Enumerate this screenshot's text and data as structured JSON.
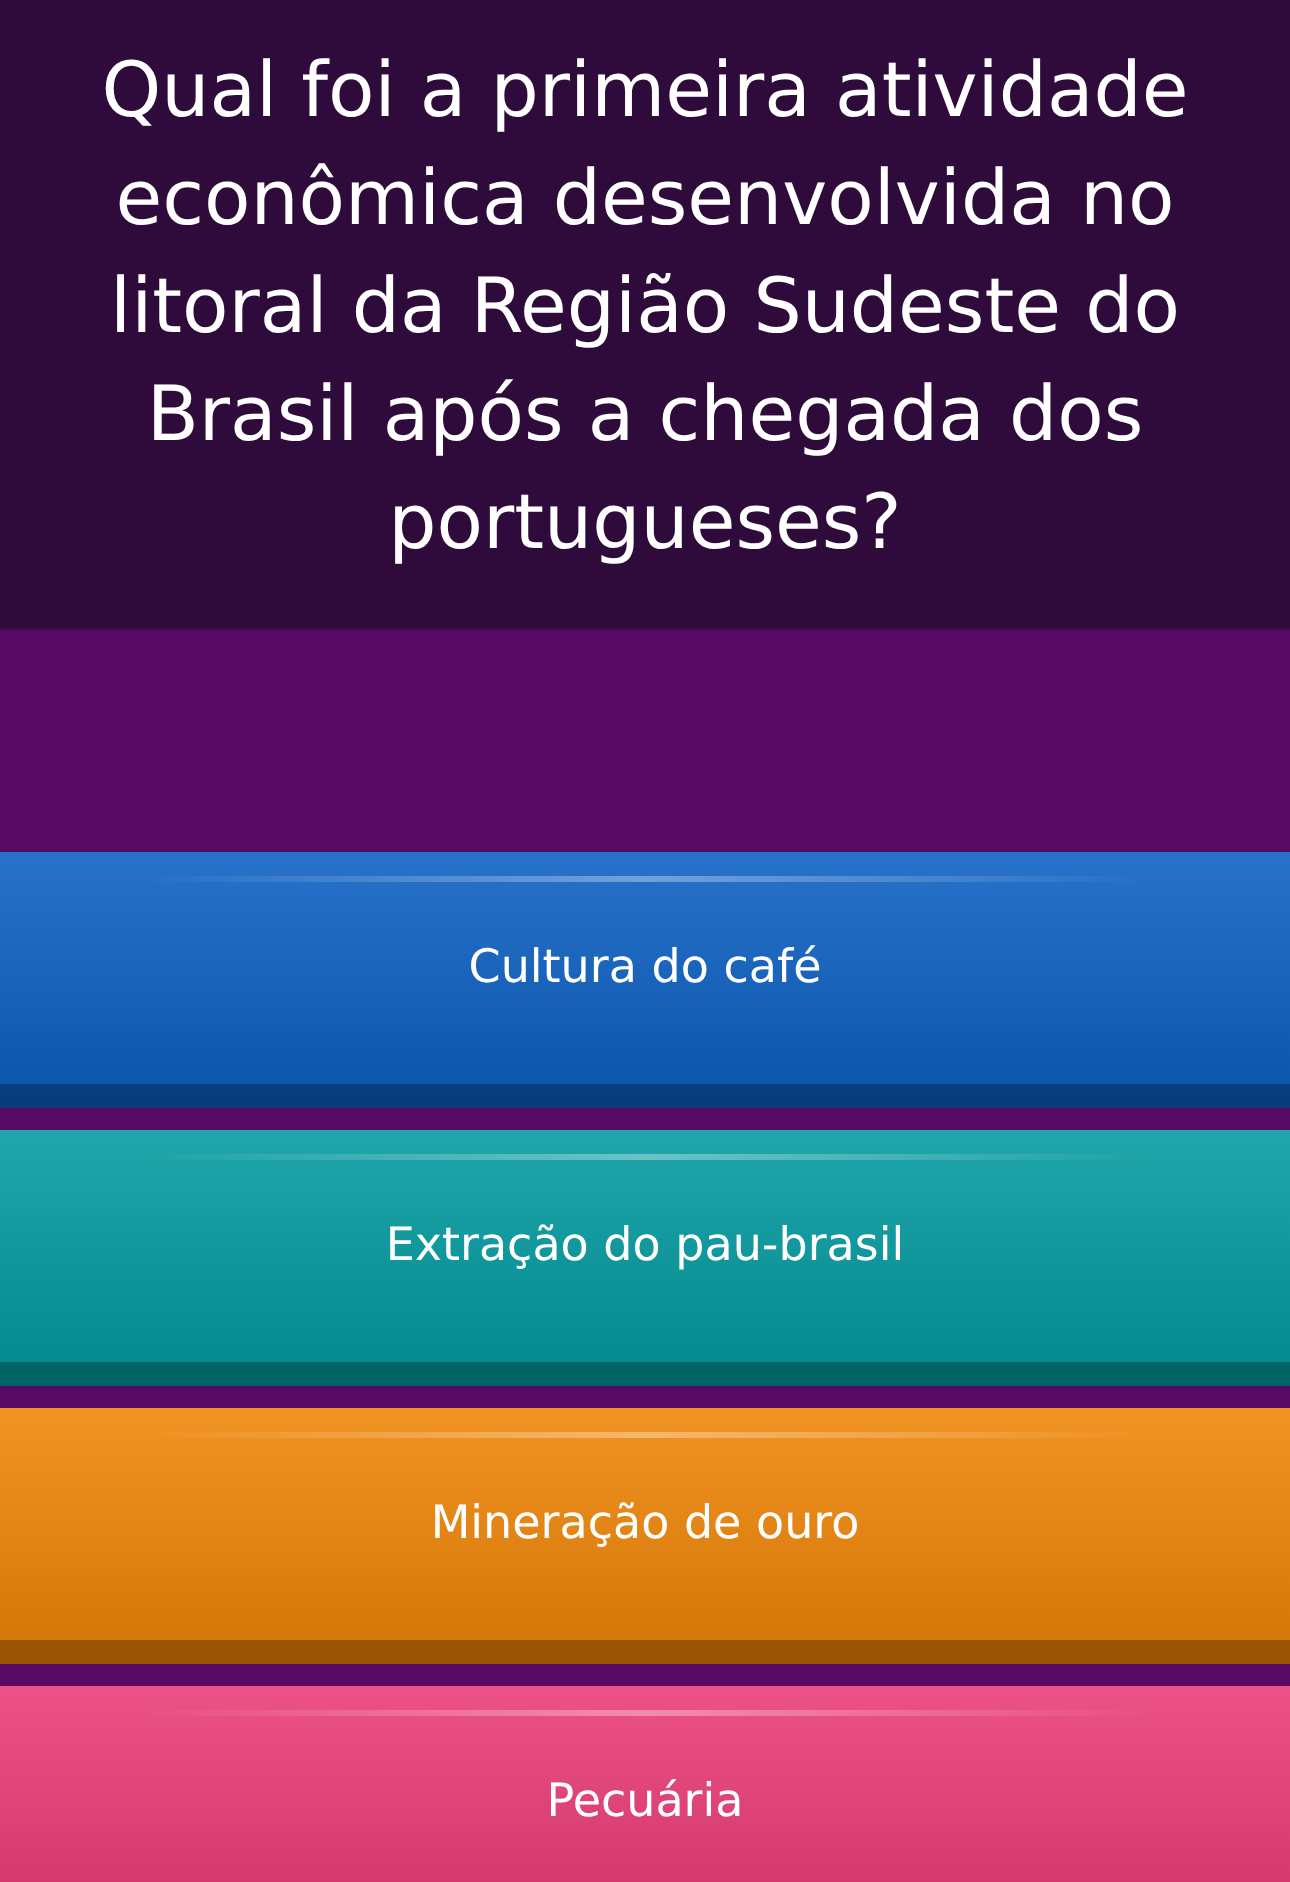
{
  "question": "Qual foi a primeira atividade econômica desenvolvida no litoral da Região Sudeste do Brasil após a chegada dos portugueses?",
  "options": [
    {
      "label": "Cultura do café",
      "color": "#0b5fc2"
    },
    {
      "label": "Extração do pau-brasil",
      "color": "#019a9f"
    },
    {
      "label": "Mineração de ouro",
      "color": "#f08506"
    },
    {
      "label": "Pecuária",
      "color": "#ea3a74"
    }
  ]
}
